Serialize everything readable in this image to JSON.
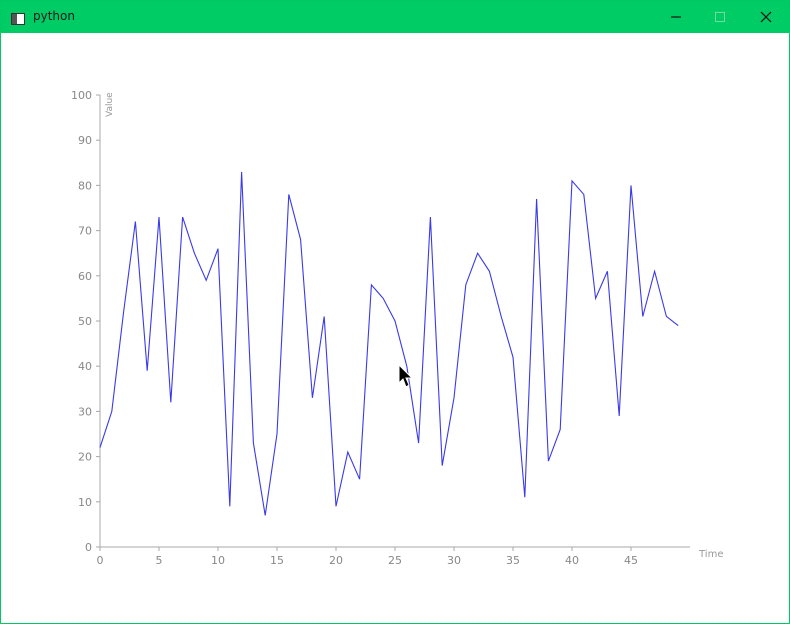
{
  "window": {
    "title": "python",
    "controls": [
      "minimize-icon",
      "maximize-icon",
      "close-icon"
    ]
  },
  "colors": {
    "titlebar": "#00cc66",
    "series": "#3a3ae8",
    "axis": "#a8a8a8"
  },
  "chart_data": {
    "type": "line",
    "title": "",
    "xlabel": "Time",
    "ylabel": "Value",
    "xlim": [
      0,
      50
    ],
    "ylim": [
      0,
      100
    ],
    "x_ticks": [
      0,
      5,
      10,
      15,
      20,
      25,
      30,
      35,
      40,
      45
    ],
    "y_ticks": [
      0,
      10,
      20,
      30,
      40,
      50,
      60,
      70,
      80,
      90,
      100
    ],
    "grid": false,
    "series": [
      {
        "x": [
          0,
          1,
          2,
          3,
          4,
          5,
          6,
          7,
          8,
          9,
          10,
          11,
          12,
          13,
          14,
          15,
          16,
          17,
          18,
          19,
          20,
          21,
          22,
          23,
          24,
          25,
          26,
          27,
          28,
          29,
          30,
          31,
          32,
          33,
          34,
          35,
          36,
          37,
          38,
          39,
          40,
          41,
          42,
          43,
          44,
          45,
          46,
          47,
          48,
          49
        ],
        "values": [
          22,
          30,
          52,
          72,
          39,
          73,
          32,
          73,
          65,
          59,
          66,
          9,
          83,
          23,
          7,
          25,
          78,
          68,
          33,
          51,
          9,
          21,
          15,
          58,
          55,
          50,
          40,
          23,
          73,
          18,
          33,
          58,
          65,
          61,
          51,
          42,
          11,
          77,
          19,
          26,
          81,
          78,
          55,
          61,
          29,
          80,
          51,
          61,
          51,
          49
        ]
      }
    ]
  }
}
